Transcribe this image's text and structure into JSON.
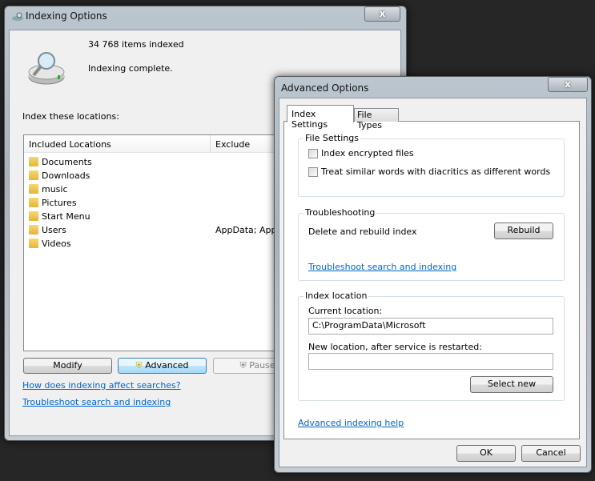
{
  "main": {
    "title": "Indexing Options",
    "close": "x",
    "items_indexed": "34 768 items indexed",
    "status": "Indexing complete.",
    "locations_label": "Index these locations:",
    "columns": [
      "Included Locations",
      "Exclude"
    ],
    "locations": [
      {
        "name": "Documents",
        "exclude": ""
      },
      {
        "name": "Downloads",
        "exclude": ""
      },
      {
        "name": "music",
        "exclude": ""
      },
      {
        "name": "Pictures",
        "exclude": ""
      },
      {
        "name": "Start Menu",
        "exclude": ""
      },
      {
        "name": "Users",
        "exclude": "AppData; AppDa"
      },
      {
        "name": "Videos",
        "exclude": ""
      }
    ],
    "buttons": {
      "modify": "Modify",
      "advanced": "Advanced",
      "pause": "Pause"
    },
    "links": {
      "how": "How does indexing affect searches?",
      "troubleshoot": "Troubleshoot search and indexing"
    }
  },
  "advanced": {
    "title": "Advanced Options",
    "close": "x",
    "tabs": [
      "Index Settings",
      "File Types"
    ],
    "file_settings": {
      "label": "File Settings",
      "options": [
        {
          "label": "Index encrypted files",
          "checked": false
        },
        {
          "label": "Treat similar words with diacritics as different words",
          "checked": false
        }
      ]
    },
    "troubleshooting": {
      "label": "Troubleshooting",
      "text": "Delete and rebuild index",
      "rebuild": "Rebuild",
      "link": "Troubleshoot search and indexing"
    },
    "index_location": {
      "label": "Index location",
      "current_label": "Current location:",
      "current_value": "C:\\ProgramData\\Microsoft",
      "new_label": "New location, after service is restarted:",
      "new_value": "",
      "select_new": "Select new"
    },
    "help_link": "Advanced indexing help",
    "ok": "OK",
    "cancel": "Cancel"
  }
}
